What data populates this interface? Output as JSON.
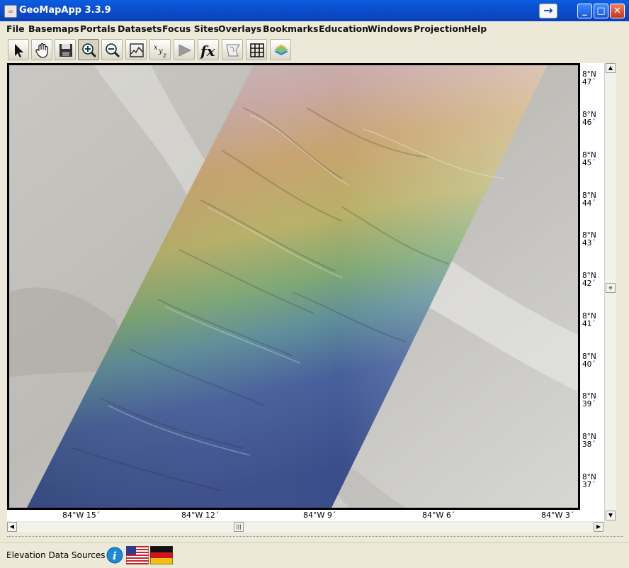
{
  "window": {
    "title": "GeoMapApp 3.3.9"
  },
  "menu": {
    "items": [
      "File",
      "Basemaps",
      "Portals",
      "Datasets",
      "Focus Sites",
      "Overlays",
      "Bookmarks",
      "Education",
      "Windows",
      "Projection",
      "Help"
    ]
  },
  "toolbar": {
    "tools": [
      "select-arrow-icon",
      "pan-hand-icon",
      "save-disk-icon",
      "zoom-in-icon",
      "zoom-out-icon",
      "profile-icon",
      "xyz-icon",
      "flag-icon",
      "function-fx-icon",
      "contour-icon",
      "grid-icon",
      "layers-icon"
    ],
    "active": "zoom-in-icon"
  },
  "map": {
    "lat_labels": [
      {
        "deg": "8°N",
        "min": "47´"
      },
      {
        "deg": "8°N",
        "min": "46´"
      },
      {
        "deg": "8°N",
        "min": "45´"
      },
      {
        "deg": "8°N",
        "min": "44´"
      },
      {
        "deg": "8°N",
        "min": "43´"
      },
      {
        "deg": "8°N",
        "min": "42´"
      },
      {
        "deg": "8°N",
        "min": "41´"
      },
      {
        "deg": "8°N",
        "min": "40´"
      },
      {
        "deg": "8°N",
        "min": "39´"
      },
      {
        "deg": "8°N",
        "min": "38´"
      },
      {
        "deg": "8°N",
        "min": "37´"
      }
    ],
    "lon_labels": [
      "84°W 15´",
      "84°W 12´",
      "84°W 9´",
      "84°W 6´",
      "84°W 3´"
    ]
  },
  "status": {
    "label": "Elevation Data Sources"
  },
  "colors": {
    "title_bar": "#0c4fd0",
    "deep": "#3d4f8e",
    "shallow": "#c9a46a"
  }
}
